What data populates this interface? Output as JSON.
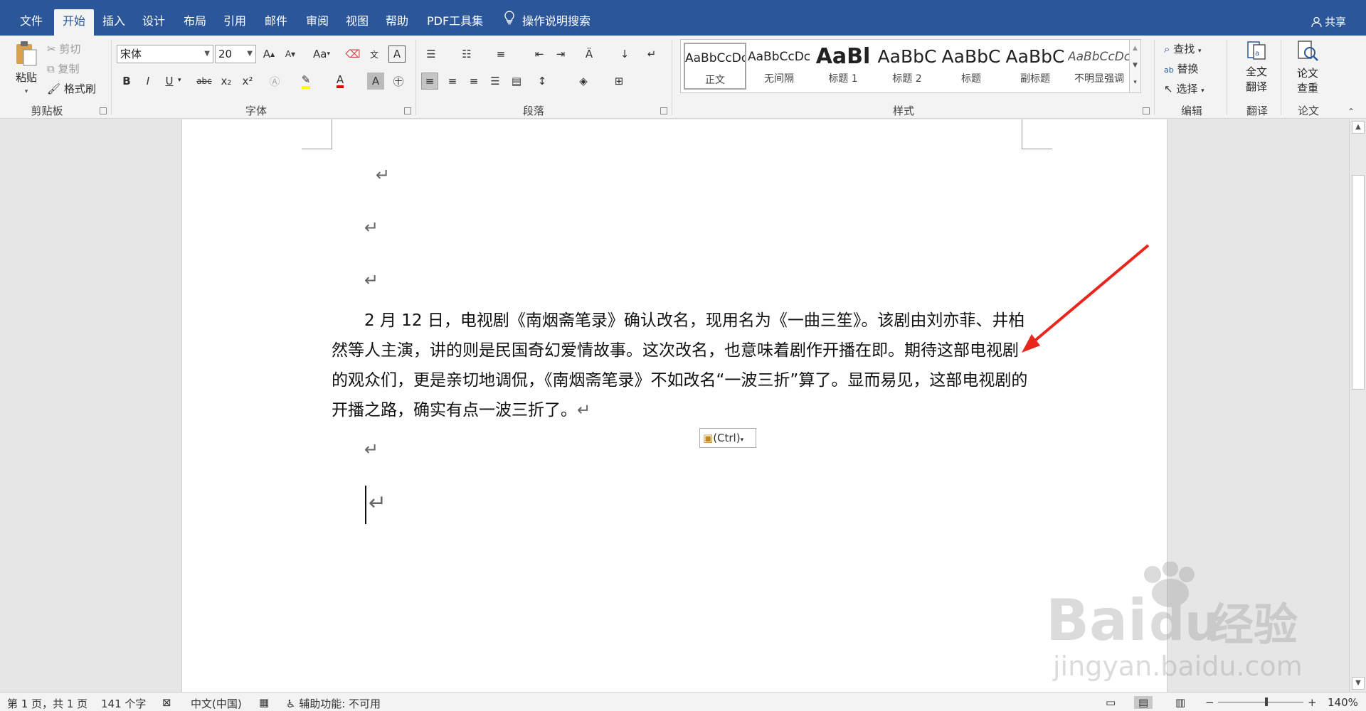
{
  "tabs": [
    {
      "label": "文件"
    },
    {
      "label": "开始"
    },
    {
      "label": "插入"
    },
    {
      "label": "设计"
    },
    {
      "label": "布局"
    },
    {
      "label": "引用"
    },
    {
      "label": "邮件"
    },
    {
      "label": "审阅"
    },
    {
      "label": "视图"
    },
    {
      "label": "帮助"
    },
    {
      "label": "PDF工具集"
    },
    {
      "label": "操作说明搜索"
    }
  ],
  "active_tab": "开始",
  "share_label": "共享",
  "clipboard": {
    "paste": "粘贴",
    "cut": "剪切",
    "copy": "复制",
    "format_painter": "格式刷",
    "group": "剪贴板"
  },
  "font": {
    "name": "宋体",
    "size": "20",
    "case_label": "Aa",
    "group": "字体",
    "bold": "B",
    "italic": "I",
    "underline": "U",
    "strike": "abc",
    "sub": "x₂",
    "sup": "x²",
    "grow": "A",
    "shrink": "A",
    "font_color": "A",
    "font_color_hex": "#e00000",
    "shading": "A"
  },
  "paragraph": {
    "group": "段落"
  },
  "styles": {
    "group": "样式",
    "items": [
      {
        "sample": "AaBbCcDc",
        "name": "正文"
      },
      {
        "sample": "AaBbCcDc",
        "name": "无间隔"
      },
      {
        "sample": "AaBl",
        "name": "标题 1"
      },
      {
        "sample": "AaBbC",
        "name": "标题 2"
      },
      {
        "sample": "AaBbC",
        "name": "标题"
      },
      {
        "sample": "AaBbC",
        "name": "副标题"
      },
      {
        "sample": "AaBbCcDc",
        "name": "不明显强调"
      }
    ]
  },
  "editing": {
    "find": "查找",
    "replace": "替换",
    "select": "选择",
    "group": "编辑"
  },
  "translate": {
    "button": "全文翻译",
    "line1": "全文",
    "line2": "翻译",
    "group": "翻译"
  },
  "paper": {
    "line1": "论文",
    "line2": "查重",
    "group": "论文"
  },
  "document": {
    "paragraph": "2 月 12 日，电视剧《南烟斋笔录》确认改名，现用名为《一曲三笙》。该剧由刘亦菲、井柏然等人主演，讲的则是民国奇幻爱情故事。这次改名，也意味着剧作开播在即。期待这部电视剧的观众们，更是亲切地调侃，《南烟斋笔录》不如改名“一波三折”算了。显而易见，这部电视剧的开播之路，确实有点一波三折了。",
    "para_mark": "↵",
    "paste_options": "(Ctrl)"
  },
  "status": {
    "page": "第 1 页，共 1 页",
    "words": "141 个字",
    "language": "中文(中国)",
    "accessibility": "辅助功能: 不可用",
    "zoom": "140%"
  },
  "watermark": {
    "brand": "Bai",
    "brand2": "du",
    "suffix": "经验",
    "url": "jingyan.baidu.com"
  },
  "colors": {
    "tab_bar": "#2b579a",
    "arrow": "#e8261d"
  }
}
